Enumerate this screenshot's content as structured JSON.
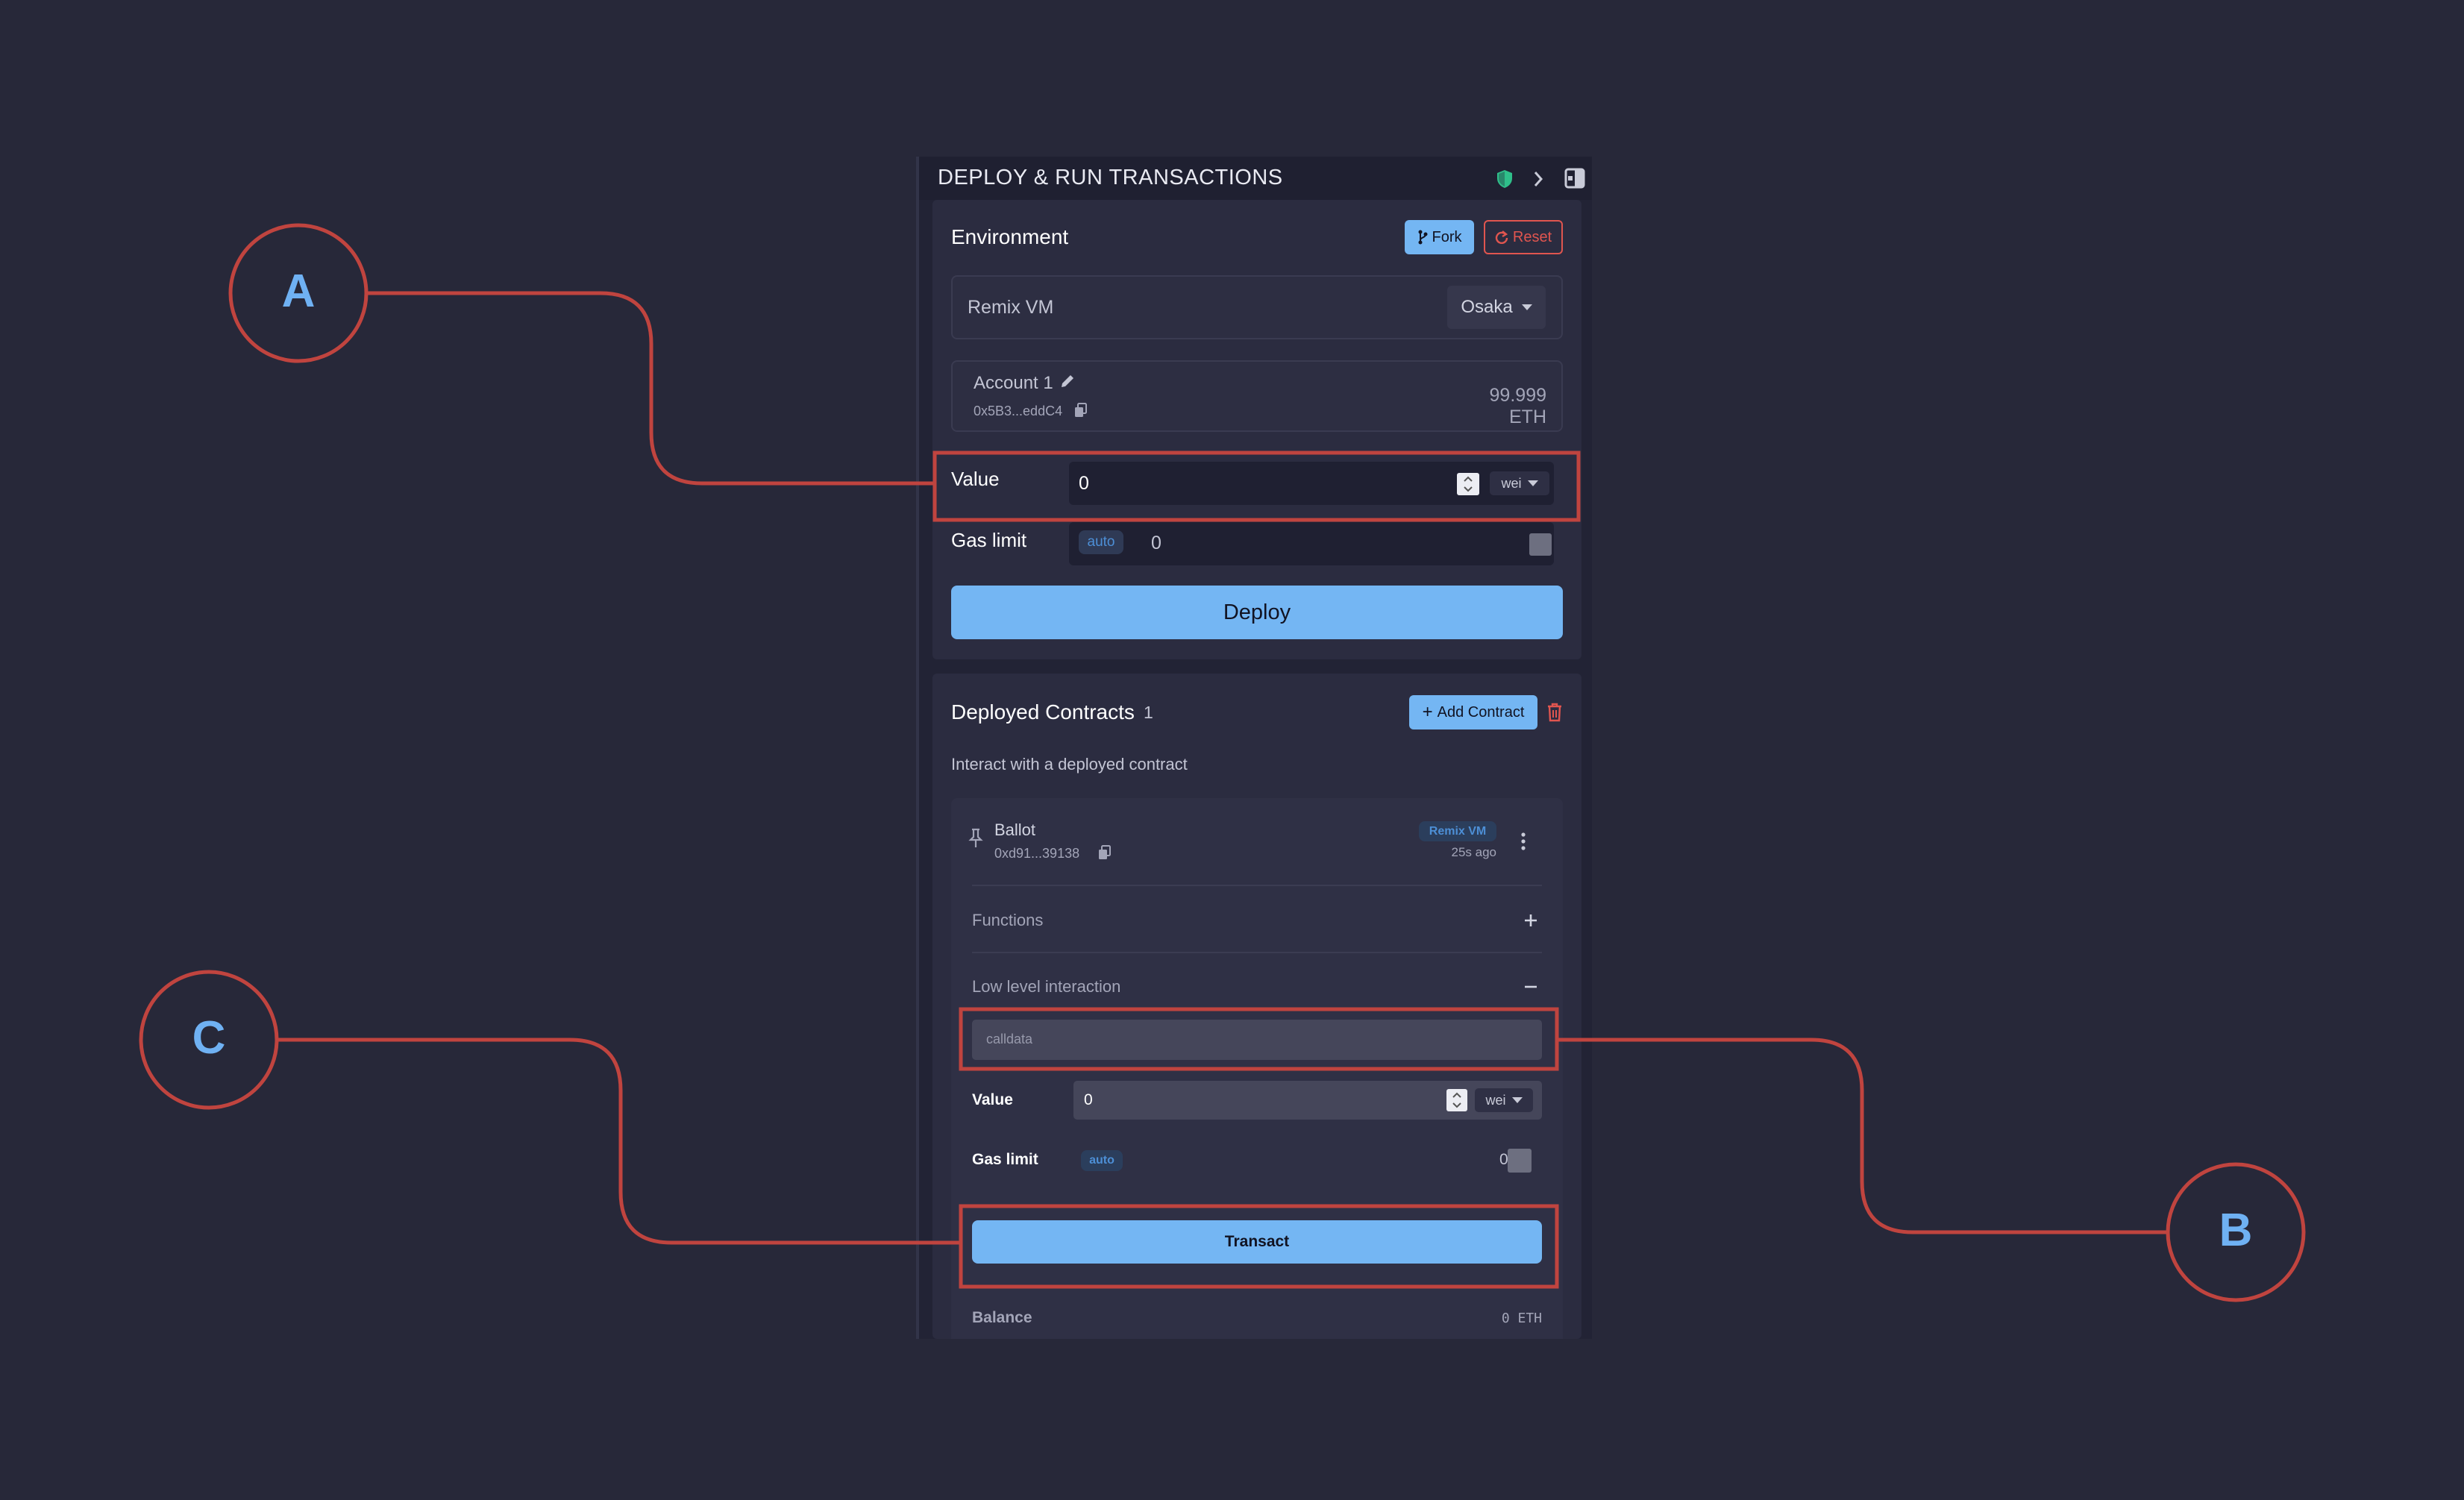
{
  "panel": {
    "title": "DEPLOY & RUN TRANSACTIONS",
    "header_icons": [
      "shield-icon",
      "chevron-right-icon",
      "panel-toggle-icon"
    ]
  },
  "environment": {
    "heading": "Environment",
    "fork_label": "Fork",
    "reset_label": "Reset",
    "env_value": "Remix VM",
    "fork_value": "Osaka",
    "account_name": "Account 1",
    "account_address": "0x5B3...eddC4",
    "account_balance": "99.999 ETH",
    "value_label": "Value",
    "value_input": "0",
    "value_unit": "wei",
    "gas_limit_label": "Gas limit",
    "gas_mode": "auto",
    "gas_input": "0",
    "deploy_label": "Deploy"
  },
  "deployed": {
    "heading": "Deployed Contracts",
    "count": "1",
    "add_contract_label": "Add Contract",
    "hint": "Interact with a deployed contract",
    "contract": {
      "name": "Ballot",
      "address": "0xd91...39138",
      "network_badge": "Remix VM",
      "age": "25s ago",
      "functions_label": "Functions",
      "low_level_label": "Low level interaction",
      "calldata_placeholder": "calldata",
      "value_label": "Value",
      "value_input": "0",
      "value_unit": "wei",
      "gas_limit_label": "Gas limit",
      "gas_mode": "auto",
      "gas_input": "0",
      "transact_label": "Transact",
      "balance_label": "Balance",
      "balance_value": "0 ETH"
    }
  },
  "callouts": {
    "a": "A",
    "b": "B",
    "c": "C"
  },
  "colors": {
    "background": "#272839",
    "accent_blue": "#74b6f3",
    "callout_red": "#c0443f",
    "danger_red": "#e0554f",
    "success_green": "#2fbf8a"
  }
}
